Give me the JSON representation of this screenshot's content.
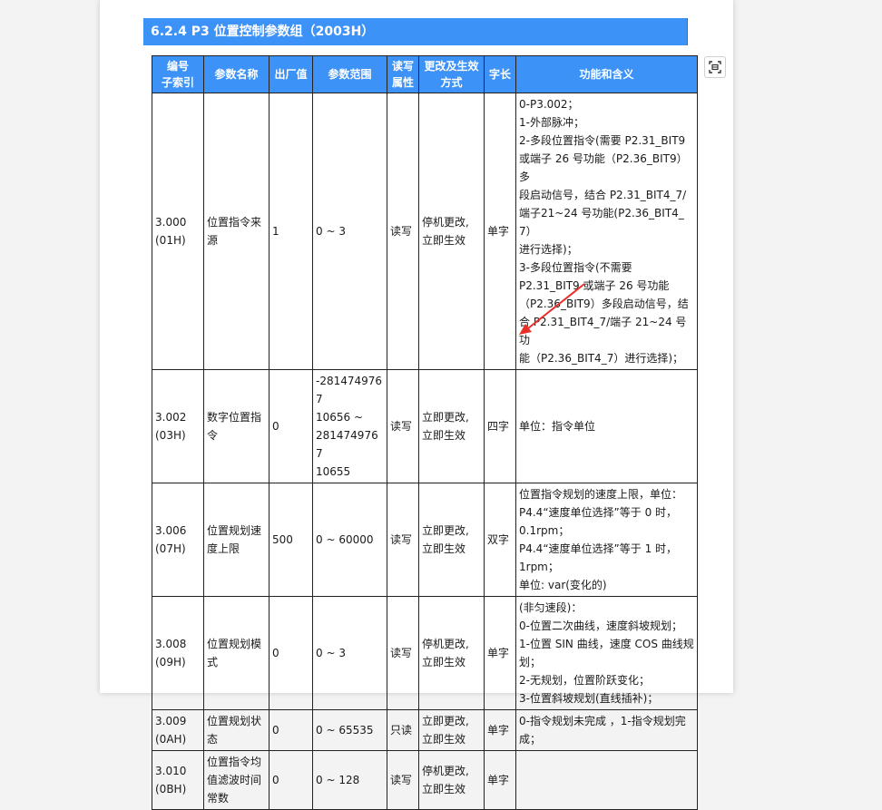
{
  "section": {
    "title": "6.2.4  P3  位置控制参数组（2003H）"
  },
  "table": {
    "headers": {
      "index": [
        "编号",
        "子索引"
      ],
      "name": "参数名称",
      "default": "出厂值",
      "range": "参数范围",
      "rw": [
        "读写",
        "属性"
      ],
      "effect": [
        "更改及生效",
        "方式"
      ],
      "length": "字长",
      "function": "功能和含义"
    },
    "rows": [
      {
        "index": [
          "3.000",
          "(01H)"
        ],
        "name": "位置指令来源",
        "default": "1",
        "range": [
          "0 ~ 3"
        ],
        "rw": "读写",
        "effect": [
          "停机更改,",
          "立即生效"
        ],
        "length": "单字",
        "func": [
          "0-P3.002；",
          "1-外部脉冲；",
          "2-多段位置指令(需要 P2.31_BIT9",
          "或端子 26 号功能（P2.36_BIT9）多",
          "段启动信号，结合 P2.31_BIT4_7/",
          "端子21~24 号功能(P2.36_BIT4_7）",
          "进行选择)；",
          "3-多段位置指令(不需要",
          "P2.31_BIT9 或端子 26 号功能",
          "（P2.36_BIT9）多段启动信号，结",
          "合 P2.31_BIT4_7/端子 21~24 号功",
          "能（P2.36_BIT4_7）进行选择)；"
        ]
      },
      {
        "index": [
          "3.002",
          "(03H)"
        ],
        "name": "数字位置指令",
        "default": "0",
        "range": [
          "-2814749767",
          "10656 ~",
          "2814749767",
          "10655"
        ],
        "rw": "读写",
        "effect": [
          "立即更改,",
          "立即生效"
        ],
        "length": "四字",
        "func": [
          "单位：指令单位"
        ]
      },
      {
        "index": [
          "3.006",
          "(07H)"
        ],
        "name": "位置规划速度上限",
        "default": "500",
        "range": [
          "0 ~ 60000"
        ],
        "rw": "读写",
        "effect": [
          "立即更改,",
          "立即生效"
        ],
        "length": "双字",
        "func": [
          "位置指令规划的速度上限，单位：",
          "P4.4“速度单位选择”等于 0 时，",
          "0.1rpm；",
          "P4.4“速度单位选择”等于 1 时，",
          "1rpm；",
          "单位: var(变化的)"
        ]
      },
      {
        "index": [
          "3.008",
          "(09H)"
        ],
        "name": "位置规划模式",
        "default": "0",
        "range": [
          "0 ~ 3"
        ],
        "rw": "读写",
        "effect": [
          "停机更改,",
          "立即生效"
        ],
        "length": "单字",
        "func": [
          "(非匀速段)：",
          "0-位置二次曲线，速度斜坡规划；",
          "1-位置 SIN 曲线，速度 COS 曲线规",
          "划；",
          "2-无规划，位置阶跃变化；",
          "3-位置斜坡规划(直线插补)；"
        ]
      },
      {
        "index": [
          "3.009",
          "(0AH)"
        ],
        "name": "位置规划状态",
        "default": "0",
        "range": [
          "0 ~ 65535"
        ],
        "rw": "只读",
        "effect": [
          "立即更改,",
          "立即生效"
        ],
        "length": "单字",
        "func": [
          "0-指令规划未完成 ，1-指令规划完",
          "成；"
        ]
      },
      {
        "index": [
          "3.010",
          "(0BH)"
        ],
        "name": "位置指令均值滤波时间常数",
        "default": "0",
        "range": [
          "0 ~ 128"
        ],
        "rw": "读写",
        "effect": [
          "停机更改,",
          "立即生效"
        ],
        "length": "单字",
        "func": []
      }
    ]
  },
  "colors": {
    "header_blue": "#3d92f7",
    "annotation_red": "#e8302a"
  },
  "icons": {
    "side_button": "fullscreen-icon",
    "annotation": "arrow-annotation"
  }
}
